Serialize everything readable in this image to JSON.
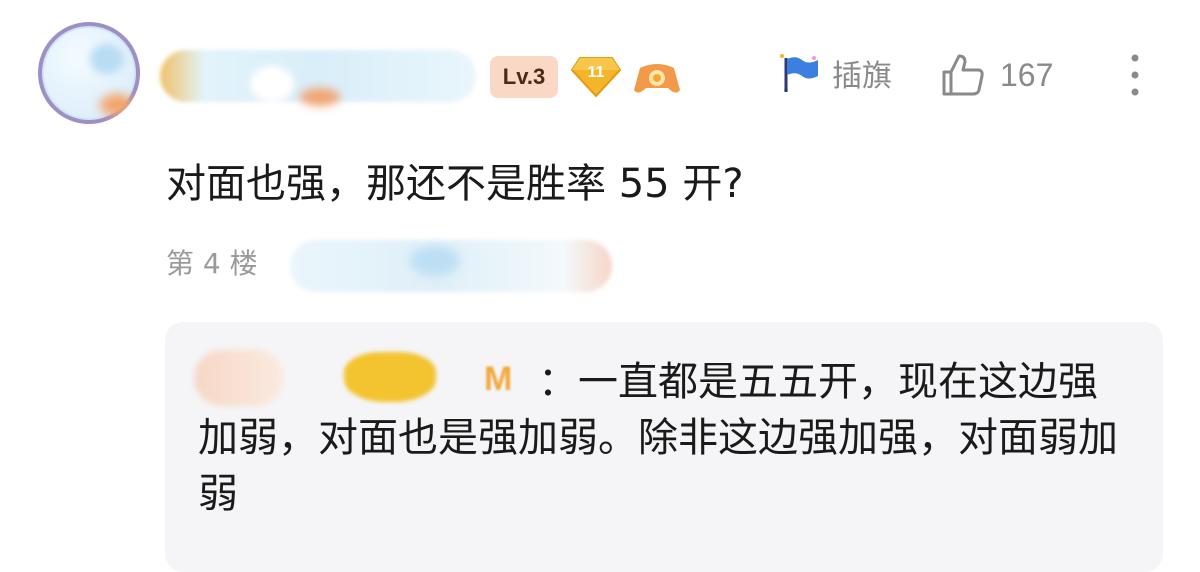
{
  "header": {
    "level_label": "Lv.3",
    "gem_count": "11",
    "flag_label": "插旗",
    "like_count": "167",
    "icons": {
      "avatar": "user-avatar",
      "gem": "diamond-badge-icon",
      "game": "gamepad-badge-icon",
      "flag": "flag-icon",
      "like": "thumbs-up-icon",
      "more": "more-vertical-icon"
    }
  },
  "comment": {
    "text": "对面也强，那还不是胜率 55 开?",
    "floor": "第 4 楼"
  },
  "reply": {
    "text": "：一直都是五五开，现在这边强加弱，对面也是强加弱。除非这边强加强，对面弱加弱"
  },
  "colors": {
    "text": "#1a1a1a",
    "muted": "#8a8a8a",
    "reply_bg": "#f5f5f7",
    "level_badge_bg": "#f9d9c6",
    "gem": "#f5b52a"
  }
}
